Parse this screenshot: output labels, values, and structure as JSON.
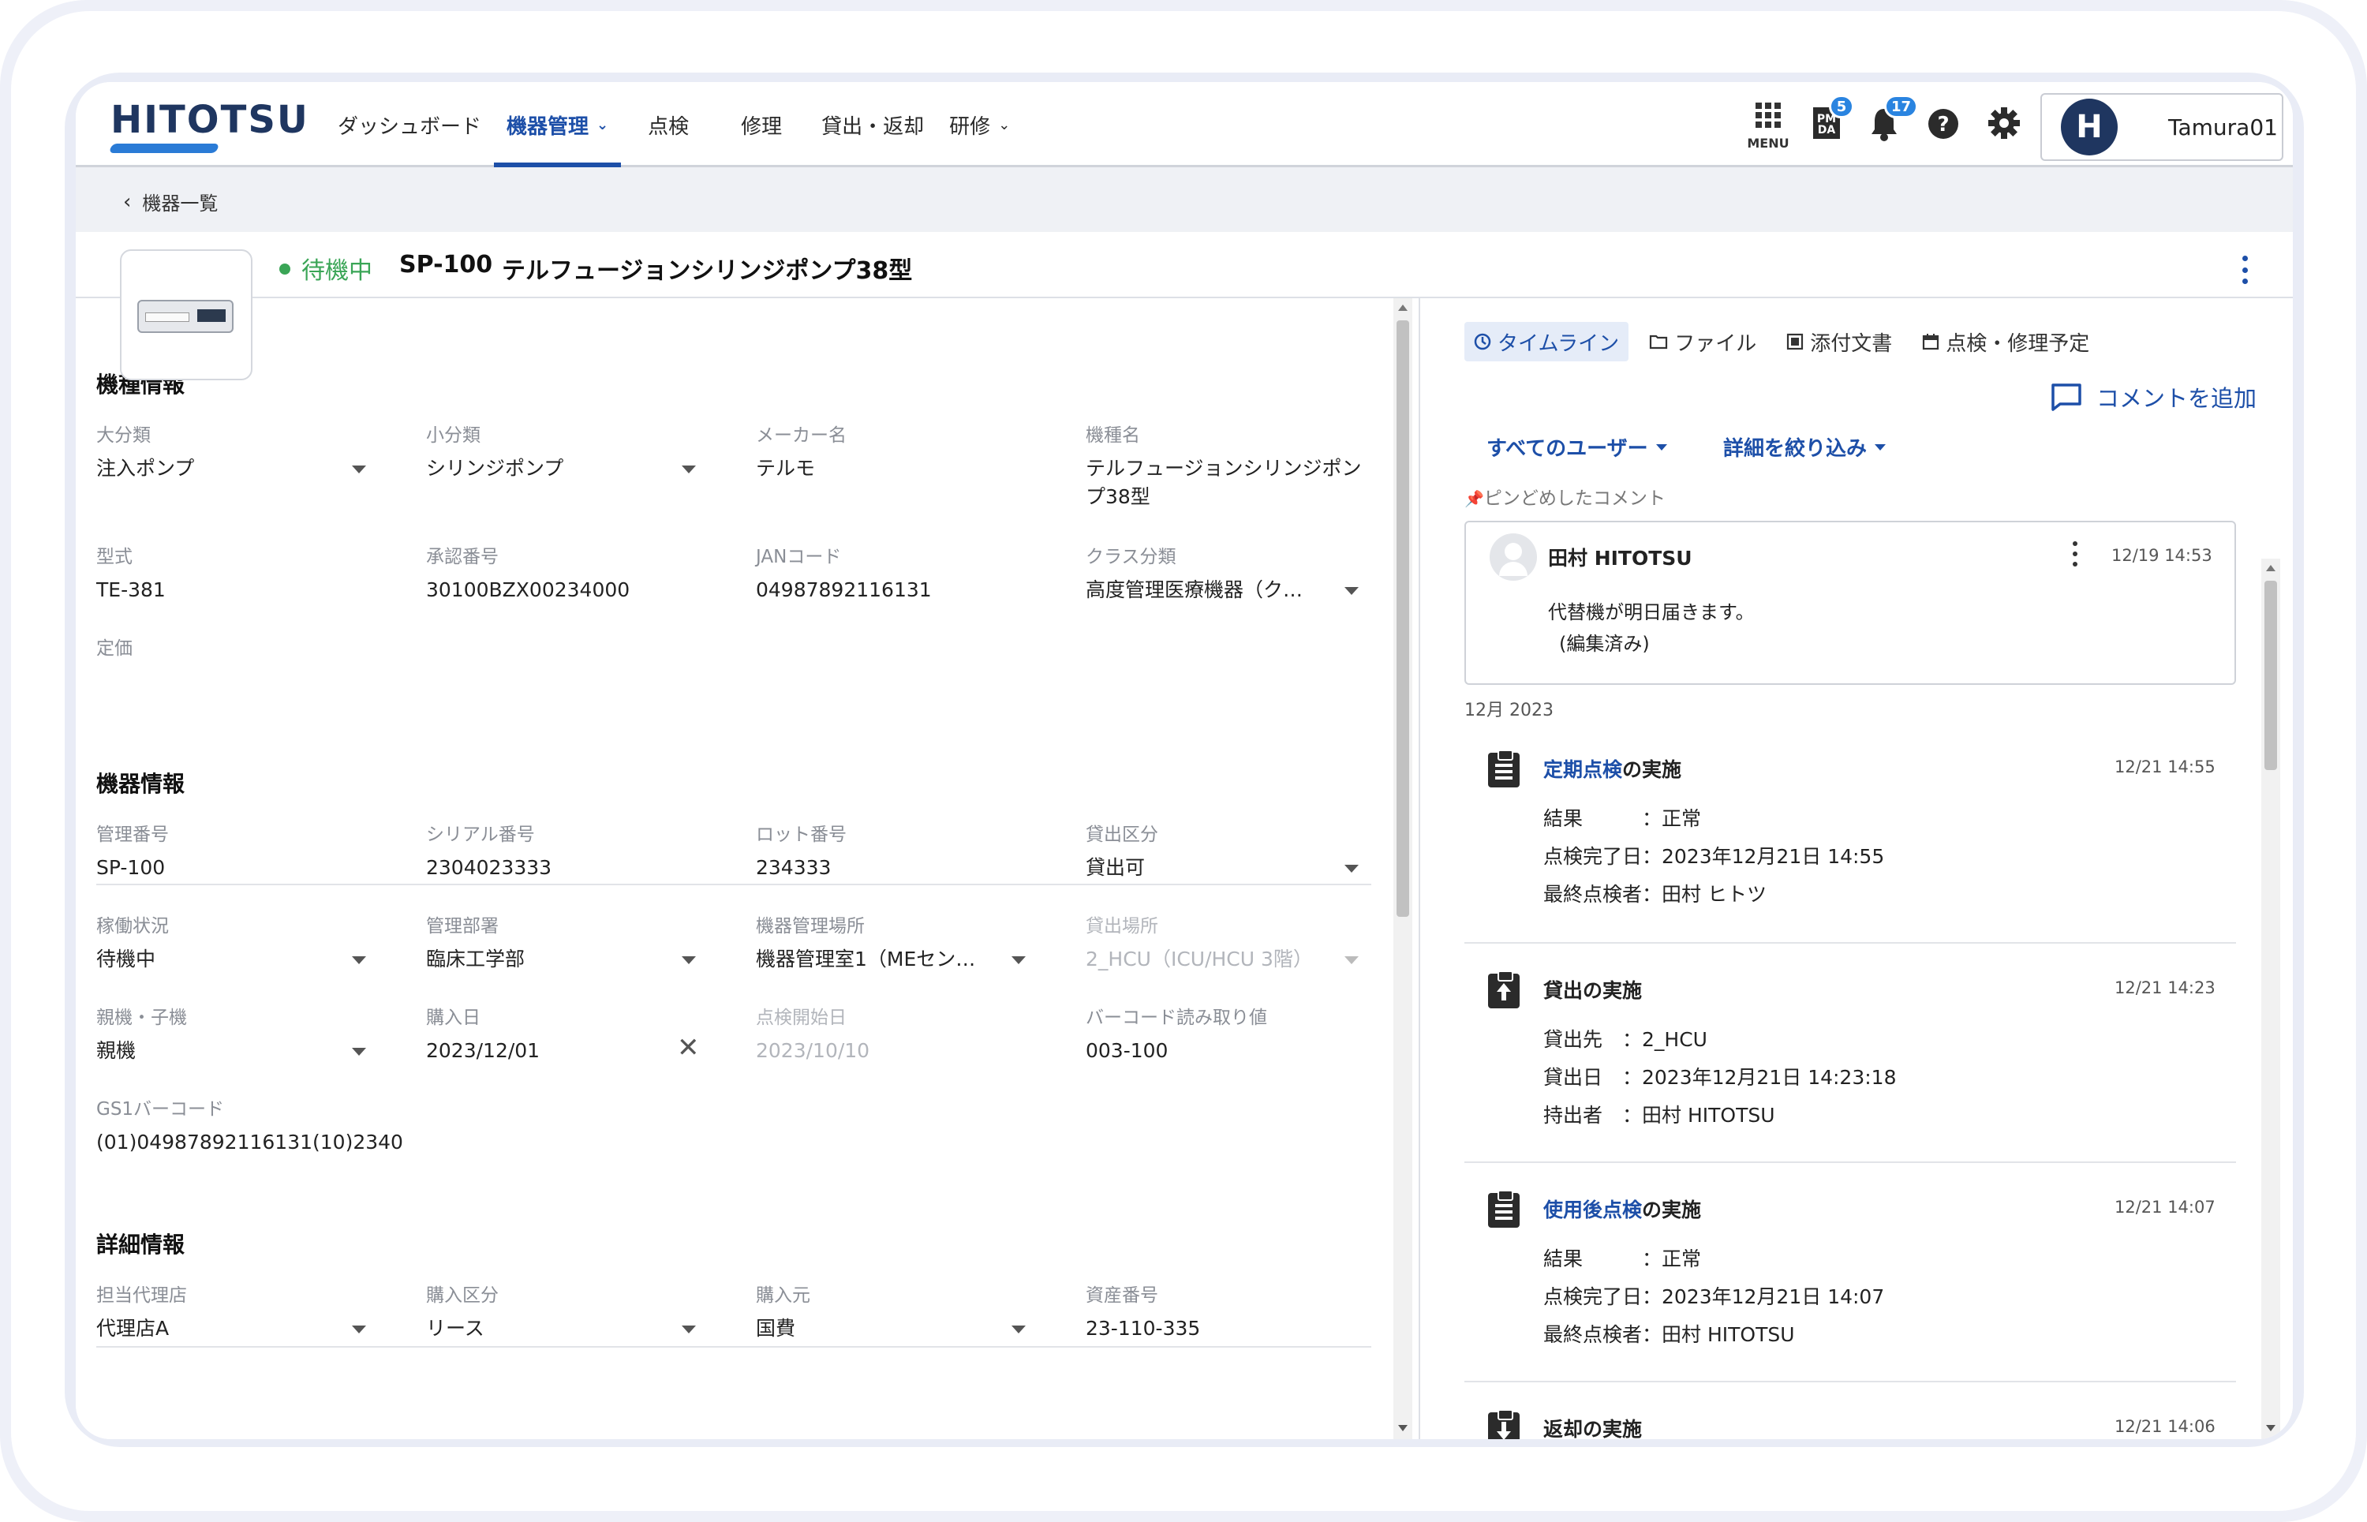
{
  "header": {
    "logo": "HITOTSU",
    "nav": [
      {
        "label": "ダッシュボード",
        "dropdown": false,
        "active": false
      },
      {
        "label": "機器管理",
        "dropdown": true,
        "active": true
      },
      {
        "label": "点検",
        "dropdown": false,
        "active": false
      },
      {
        "label": "修理",
        "dropdown": false,
        "active": false
      },
      {
        "label": "貸出・返却",
        "dropdown": false,
        "active": false
      },
      {
        "label": "研修",
        "dropdown": true,
        "active": false
      }
    ],
    "menu_label": "MENU",
    "pmda_label": "PM DA",
    "pmda_badge": "5",
    "notification_badge": "17",
    "user_initial": "H",
    "user_name": "Tamura01"
  },
  "breadcrumb": {
    "back_label": "機器一覧"
  },
  "device": {
    "status": "待機中",
    "code": "SP-100",
    "name": "テルフュージョンシリンジポンプ38型"
  },
  "sections": {
    "model_info": {
      "title": "機種情報",
      "fields": [
        {
          "label": "大分類",
          "value": "注入ポンプ"
        },
        {
          "label": "小分類",
          "value": "シリンジポンプ"
        },
        {
          "label": "メーカー名",
          "value": "テルモ"
        },
        {
          "label": "機種名",
          "value": "テルフュージョンシリンジポンプ38型"
        },
        {
          "label": "型式",
          "value": "TE-381"
        },
        {
          "label": "承認番号",
          "value": "30100BZX00234000"
        },
        {
          "label": "JANコード",
          "value": "04987892116131"
        },
        {
          "label": "クラス分類",
          "value": "高度管理医療機器（ク…"
        },
        {
          "label": "定価",
          "value": ""
        }
      ]
    },
    "device_info": {
      "title": "機器情報",
      "fields": [
        {
          "label": "管理番号",
          "value": "SP-100"
        },
        {
          "label": "シリアル番号",
          "value": "2304023333"
        },
        {
          "label": "ロット番号",
          "value": "234333"
        },
        {
          "label": "貸出区分",
          "value": "貸出可"
        },
        {
          "label": "稼働状況",
          "value": "待機中"
        },
        {
          "label": "管理部署",
          "value": "臨床工学部"
        },
        {
          "label": "機器管理場所",
          "value": "機器管理室1（MEセン…"
        },
        {
          "label": "貸出場所",
          "value": "2_HCU（ICU/HCU 3階）"
        },
        {
          "label": "親機・子機",
          "value": "親機"
        },
        {
          "label": "購入日",
          "value": "2023/12/01"
        },
        {
          "label": "点検開始日",
          "value": "2023/10/10"
        },
        {
          "label": "バーコード読み取り値",
          "value": "003-100"
        },
        {
          "label": "GS1バーコード",
          "value": "(01)04987892116131(10)2340"
        }
      ]
    },
    "detail_info": {
      "title": "詳細情報",
      "fields": [
        {
          "label": "担当代理店",
          "value": "代理店A"
        },
        {
          "label": "購入区分",
          "value": "リース"
        },
        {
          "label": "購入元",
          "value": "国費"
        },
        {
          "label": "資産番号",
          "value": "23-110-335"
        }
      ]
    }
  },
  "right": {
    "tabs": [
      {
        "label": "タイムライン",
        "icon": "clock-icon",
        "active": true
      },
      {
        "label": "ファイル",
        "icon": "folder-icon",
        "active": false
      },
      {
        "label": "添付文書",
        "icon": "document-icon",
        "active": false
      },
      {
        "label": "点検・修理予定",
        "icon": "calendar-icon",
        "active": false
      }
    ],
    "add_comment": "コメントを追加",
    "filter_users": "すべてのユーザー",
    "filter_details": "詳細を絞り込み",
    "pinned_label": "ピンどめしたコメント",
    "pinned_comment": {
      "author": "田村 HITOTSU",
      "time": "12/19 14:53",
      "body": "代替機が明日届きます。",
      "edited": "(編集済み)"
    },
    "month": "12月 2023",
    "events": [
      {
        "icon": "clipboard-icon",
        "title_link": "定期点検",
        "title_rest": "の実施",
        "time": "12/21 14:55",
        "lines": [
          "結果　　　：正常",
          "点検完了日：2023年12月21日 14:55",
          "最終点検者：田村 ヒトツ"
        ]
      },
      {
        "icon": "clipboard-up-icon",
        "title_link": "",
        "title_rest": "貸出の実施",
        "time": "12/21 14:23",
        "lines": [
          "貸出先　：2_HCU",
          "貸出日　：2023年12月21日 14:23:18",
          "持出者　：田村 HITOTSU"
        ]
      },
      {
        "icon": "clipboard-icon",
        "title_link": "使用後点検",
        "title_rest": "の実施",
        "time": "12/21 14:07",
        "lines": [
          "結果　　　：正常",
          "点検完了日：2023年12月21日 14:07",
          "最終点検者：田村 HITOTSU"
        ]
      },
      {
        "icon": "clipboard-down-icon",
        "title_link": "",
        "title_rest": "返却の実施",
        "time": "12/21 14:06",
        "lines": []
      }
    ]
  },
  "colors": {
    "accent": "#1d4fa8",
    "status_green": "#3aa556",
    "badge": "#2a84e0",
    "navy": "#1f3660"
  }
}
